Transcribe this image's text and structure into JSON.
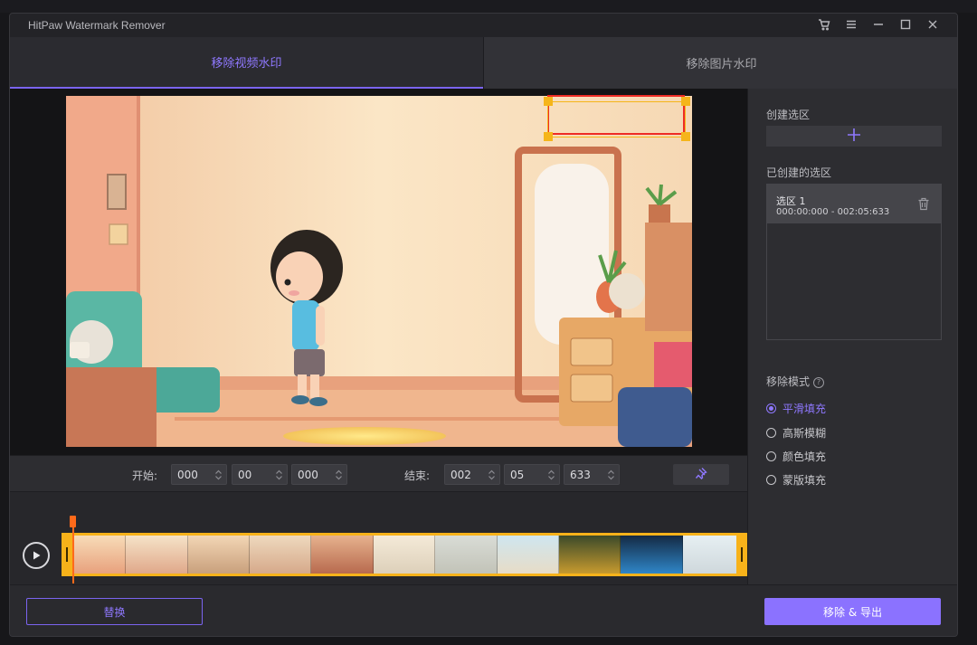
{
  "app": {
    "title": "HitPaw Watermark Remover"
  },
  "tabs": [
    {
      "label": "移除视频水印",
      "active": true
    },
    {
      "label": "移除图片水印",
      "active": false
    }
  ],
  "titlebar_icons": [
    "cart-icon",
    "menu-icon",
    "minimize-icon",
    "maximize-icon",
    "close-icon"
  ],
  "time": {
    "start_label": "开始:",
    "start": [
      "000",
      "00",
      "000"
    ],
    "end_label": "结束:",
    "end": [
      "002",
      "05",
      "633"
    ]
  },
  "sidebar": {
    "create_label": "创建选区",
    "created_label": "已创建的选区",
    "selections": [
      {
        "name": "选区 1",
        "range": "000:00:000 - 002:05:633"
      }
    ],
    "mode_label": "移除模式",
    "modes": [
      {
        "label": "平滑填充",
        "selected": true
      },
      {
        "label": "高斯模糊",
        "selected": false
      },
      {
        "label": "颜色填充",
        "selected": false
      },
      {
        "label": "蒙版填充",
        "selected": false
      }
    ]
  },
  "buttons": {
    "replace": "替换",
    "export": "移除 & 导出"
  },
  "colors": {
    "accent": "#8b72ff",
    "selection_box": "#ee2c26",
    "handles": "#f5b51a",
    "playhead": "#ff6a1a"
  }
}
